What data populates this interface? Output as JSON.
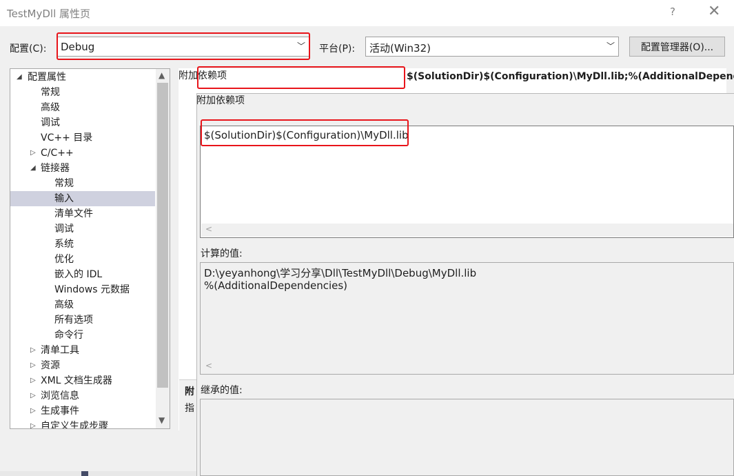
{
  "window": {
    "title": "TestMyDll 属性页",
    "help_glyph": "?",
    "close_glyph": "✕"
  },
  "config": {
    "label": "配置(C):",
    "value": "Debug",
    "platform_label": "平台(P):",
    "platform_value": "活动(Win32)",
    "manager_button": "配置管理器(O)..."
  },
  "tree": {
    "items": [
      {
        "label": "配置属性",
        "twisty": "◢"
      },
      {
        "label": "常规"
      },
      {
        "label": "高级"
      },
      {
        "label": "调试"
      },
      {
        "label": "VC++ 目录"
      },
      {
        "label": "C/C++",
        "twisty": "▷"
      },
      {
        "label": "链接器",
        "twisty": "◢"
      },
      {
        "label": "常规"
      },
      {
        "label": "输入"
      },
      {
        "label": "清单文件"
      },
      {
        "label": "调试"
      },
      {
        "label": "系统"
      },
      {
        "label": "优化"
      },
      {
        "label": "嵌入的 IDL"
      },
      {
        "label": "Windows 元数据"
      },
      {
        "label": "高级"
      },
      {
        "label": "所有选项"
      },
      {
        "label": "命令行"
      },
      {
        "label": "清单工具",
        "twisty": "▷"
      },
      {
        "label": "资源",
        "twisty": "▷"
      },
      {
        "label": "XML 文档生成器",
        "twisty": "▷"
      },
      {
        "label": "浏览信息",
        "twisty": "▷"
      },
      {
        "label": "生成事件",
        "twisty": "▷"
      },
      {
        "label": "自定义生成步骤",
        "twisty": "▷"
      }
    ],
    "selected_label": "输入"
  },
  "grid": {
    "row_name": "附加依赖项",
    "row_value": "$(SolutionDir)$(Configuration)\\MyDll.lib;%(AdditionalDepende",
    "desc_title": "附",
    "desc_text": "指"
  },
  "dialog": {
    "title": "附加依赖项",
    "edit_value": "$(SolutionDir)$(Configuration)\\MyDll.lib",
    "computed_label": "计算的值:",
    "computed_line1": "D:\\yeyanhong\\学习分享\\Dll\\TestMyDll\\Debug\\MyDll.lib",
    "computed_line2": "%(AdditionalDependencies)",
    "inherited_label": "继承的值:"
  },
  "colors": {
    "highlight_red": "#e8141a",
    "selection": "#cfd1df"
  }
}
